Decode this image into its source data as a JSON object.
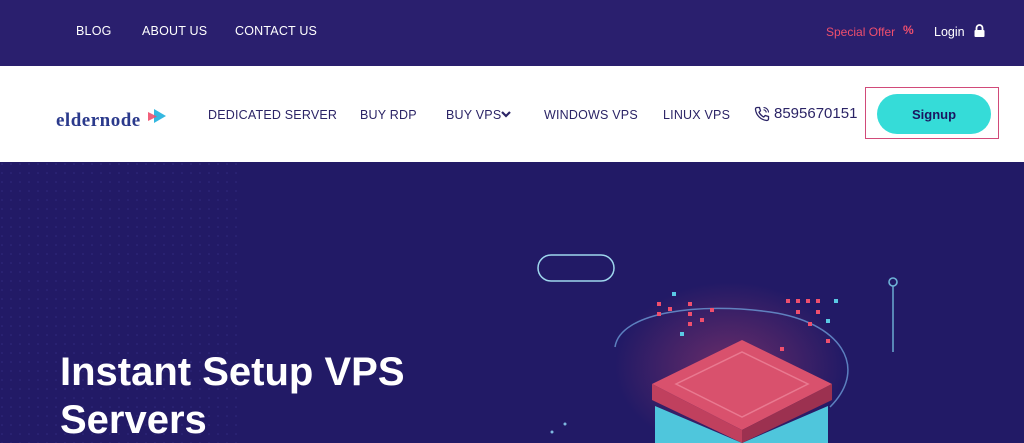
{
  "topbar": {
    "links": [
      "BLOG",
      "ABOUT US",
      "CONTACT US"
    ],
    "special_offer": "Special Offer",
    "special_icon": "%",
    "login": "Login"
  },
  "navbar": {
    "logo_text": "eldernode",
    "items": [
      "DEDICATED SERVER",
      "BUY RDP",
      "BUY VPS",
      "WINDOWS VPS",
      "LINUX VPS"
    ],
    "phone": "8595670151",
    "signup": "Signup"
  },
  "hero": {
    "title_line1": "Instant Setup VPS",
    "title_line2": "Servers"
  },
  "colors": {
    "header_bg": "#2a1f6e",
    "hero_bg": "#221a66",
    "accent_pink": "#ef4f6d",
    "signup_teal": "#35dcd8",
    "nav_text": "#2b2466"
  },
  "icons": [
    "percent-icon",
    "lock-icon",
    "chevron-down-icon",
    "phone-icon",
    "server-illustration"
  ]
}
